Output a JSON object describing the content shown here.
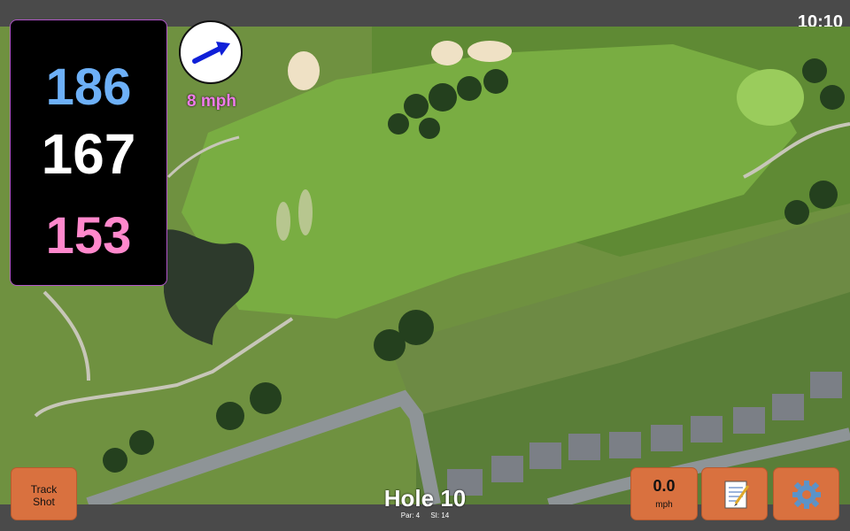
{
  "status_bar": {
    "time": "10:10"
  },
  "distances": {
    "back": "186",
    "center": "167",
    "front": "153",
    "colors": {
      "back": "#6db0f7",
      "center": "#ffffff",
      "front": "#ff88cc"
    }
  },
  "wind": {
    "icon": "wind-direction-arrow-icon",
    "speed_label": "8 mph"
  },
  "hole": {
    "title": "Hole 10",
    "par_label": "Par: 4",
    "si_label": "SI: 14"
  },
  "buttons": {
    "track_shot_line1": "Track",
    "track_shot_line2": "Shot",
    "speed_value": "0.0",
    "speed_unit": "mph",
    "notes_icon": "notepad-icon",
    "settings_icon": "gear-icon"
  },
  "colors": {
    "accent_button": "#d9713f",
    "panel_border": "#b055c8"
  }
}
